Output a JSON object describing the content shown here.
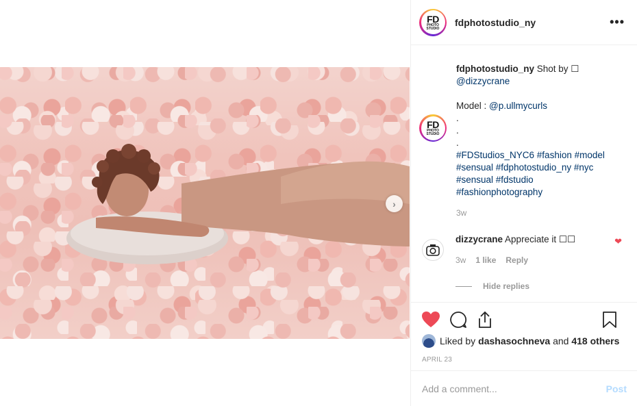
{
  "post": {
    "username": "fdphotostudio_ny",
    "logo_text_main": "FD",
    "logo_text_sub": "PHOTO STUDIO"
  },
  "caption": {
    "username": "fdphotostudio_ny",
    "line1": "Shot by ☐",
    "mention1": "@dizzycrane",
    "model_label": "Model : ",
    "mention2": "@p.ullmycurls",
    "dot1": ".",
    "dot2": ".",
    "dot3": ".",
    "hashtags": "#FDStudios_NYC6 #fashion #model #sensual #fdphotostudio_ny #nyc #sensual #fdstudio #fashionphotography",
    "time": "3w"
  },
  "reply": {
    "username": "dizzycrane",
    "text": "Appreciate it ☐☐",
    "time": "3w",
    "likes": "1 like",
    "reply_label": "Reply",
    "hide_replies": "Hide replies"
  },
  "likes": {
    "prefix": "Liked by ",
    "user": "dashasochneva",
    "middle": " and ",
    "others": "418 others"
  },
  "date": "April 23",
  "comment_box": {
    "placeholder": "Add a comment...",
    "post_label": "Post"
  },
  "colors": {
    "like_red": "#ed4956",
    "link_blue": "#003569",
    "post_disabled": "#b3dbff"
  }
}
